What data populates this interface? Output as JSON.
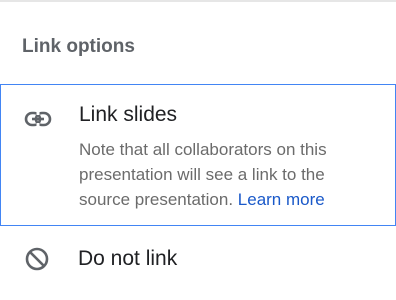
{
  "dialog": {
    "section_title": "Link options",
    "options": [
      {
        "icon": "link-icon",
        "label": "Link slides",
        "description": "Note that all collaborators on this presentation will see a link to the source presentation.",
        "link_text": "Learn more",
        "selected": true
      },
      {
        "icon": "block-icon",
        "label": "Do not link",
        "selected": false
      }
    ]
  },
  "colors": {
    "selection_border": "#4285f4",
    "link": "#1a59c9",
    "title": "#5f6368",
    "icon": "#5f6368"
  }
}
